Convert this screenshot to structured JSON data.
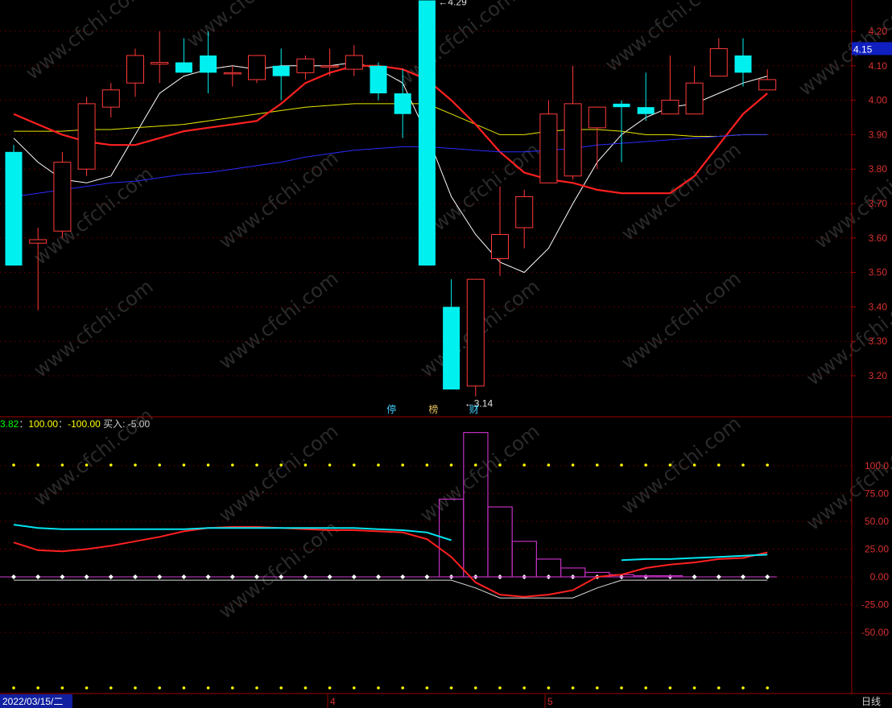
{
  "chart_data": [
    {
      "type": "candlestick",
      "title": "",
      "ylim": [
        3.1,
        4.3
      ],
      "y_ticks": [
        "4.20",
        "4.10",
        "4.00",
        "3.90",
        "3.80",
        "3.70",
        "3.60",
        "3.50",
        "3.40",
        "3.30",
        "3.20"
      ],
      "last_price": "4.15",
      "high_label": "4.29",
      "low_label": "3.14",
      "event_labels": [
        "停",
        "榜",
        "财"
      ],
      "colors": {
        "up": "#ff3a3a",
        "down": "#00f0f0",
        "ma1": "#ffffff",
        "ma2": "#e8e800",
        "ma3": "#ff2020",
        "ma4": "#2a2aff"
      },
      "candles": [
        {
          "o": 3.85,
          "h": 3.87,
          "l": 3.52,
          "c": 3.52
        },
        {
          "o": 3.585,
          "h": 3.63,
          "l": 3.39,
          "c": 3.595
        },
        {
          "o": 3.62,
          "h": 3.85,
          "l": 3.6,
          "c": 3.82
        },
        {
          "o": 3.8,
          "h": 4.01,
          "l": 3.78,
          "c": 3.99
        },
        {
          "o": 3.98,
          "h": 4.05,
          "l": 3.95,
          "c": 4.03
        },
        {
          "o": 4.05,
          "h": 4.15,
          "l": 4.01,
          "c": 4.13
        },
        {
          "o": 4.105,
          "h": 4.2,
          "l": 4.05,
          "c": 4.11
        },
        {
          "o": 4.11,
          "h": 4.18,
          "l": 4.08,
          "c": 4.08
        },
        {
          "o": 4.13,
          "h": 4.2,
          "l": 4.02,
          "c": 4.08
        },
        {
          "o": 4.08,
          "h": 4.1,
          "l": 4.04,
          "c": 4.08
        },
        {
          "o": 4.06,
          "h": 4.13,
          "l": 4.05,
          "c": 4.13
        },
        {
          "o": 4.1,
          "h": 4.15,
          "l": 4.0,
          "c": 4.07
        },
        {
          "o": 4.08,
          "h": 4.13,
          "l": 4.06,
          "c": 4.12
        },
        {
          "o": 4.1,
          "h": 4.15,
          "l": 4.07,
          "c": 4.1
        },
        {
          "o": 4.09,
          "h": 4.16,
          "l": 4.07,
          "c": 4.13
        },
        {
          "o": 4.1,
          "h": 4.11,
          "l": 4.0,
          "c": 4.02
        },
        {
          "o": 4.02,
          "h": 4.09,
          "l": 3.89,
          "c": 3.96
        },
        {
          "o": 4.29,
          "h": 4.29,
          "l": 3.52,
          "c": 3.52
        },
        {
          "o": 3.4,
          "h": 3.48,
          "l": 3.16,
          "c": 3.16
        },
        {
          "o": 3.17,
          "h": 3.48,
          "l": 3.14,
          "c": 3.48
        },
        {
          "o": 3.54,
          "h": 3.75,
          "l": 3.49,
          "c": 3.61
        },
        {
          "o": 3.63,
          "h": 3.74,
          "l": 3.57,
          "c": 3.72
        },
        {
          "o": 3.76,
          "h": 4.0,
          "l": 3.76,
          "c": 3.96
        },
        {
          "o": 3.78,
          "h": 4.1,
          "l": 3.77,
          "c": 3.99
        },
        {
          "o": 3.92,
          "h": 3.98,
          "l": 3.8,
          "c": 3.98
        },
        {
          "o": 3.99,
          "h": 4.0,
          "l": 3.82,
          "c": 3.98
        },
        {
          "o": 3.98,
          "h": 4.08,
          "l": 3.94,
          "c": 3.96
        },
        {
          "o": 3.96,
          "h": 4.13,
          "l": 3.96,
          "c": 4.0
        },
        {
          "o": 3.96,
          "h": 4.1,
          "l": 3.96,
          "c": 4.05
        },
        {
          "o": 4.07,
          "h": 4.18,
          "l": 4.07,
          "c": 4.15
        },
        {
          "o": 4.13,
          "h": 4.18,
          "l": 4.04,
          "c": 4.08
        },
        {
          "o": 4.03,
          "h": 4.09,
          "l": 4.03,
          "c": 4.06
        }
      ],
      "ma_lines": [
        {
          "name": "ma1",
          "values": [
            3.89,
            3.82,
            3.77,
            3.76,
            3.78,
            3.9,
            4.02,
            4.07,
            4.09,
            4.1,
            4.09,
            4.1,
            4.1,
            4.1,
            4.11,
            4.09,
            4.05,
            3.9,
            3.72,
            3.61,
            3.53,
            3.5,
            3.57,
            3.7,
            3.82,
            3.9,
            3.95,
            3.98,
            3.99,
            4.02,
            4.05,
            4.07
          ]
        },
        {
          "name": "ma2",
          "values": [
            3.91,
            3.91,
            3.91,
            3.915,
            3.915,
            3.92,
            3.925,
            3.93,
            3.94,
            3.95,
            3.96,
            3.97,
            3.98,
            3.985,
            3.99,
            3.99,
            3.99,
            3.99,
            3.96,
            3.93,
            3.9,
            3.9,
            3.91,
            3.915,
            3.915,
            3.91,
            3.9,
            3.9,
            3.895,
            3.895,
            3.9,
            3.9
          ]
        },
        {
          "name": "ma3",
          "values": [
            3.96,
            3.93,
            3.9,
            3.88,
            3.87,
            3.87,
            3.89,
            3.91,
            3.92,
            3.93,
            3.94,
            3.99,
            4.05,
            4.08,
            4.1,
            4.1,
            4.09,
            4.06,
            4.0,
            3.93,
            3.85,
            3.79,
            3.77,
            3.76,
            3.74,
            3.73,
            3.73,
            3.73,
            3.78,
            3.87,
            3.96,
            4.02
          ]
        },
        {
          "name": "ma4",
          "values": [
            3.72,
            3.73,
            3.74,
            3.75,
            3.76,
            3.765,
            3.775,
            3.785,
            3.79,
            3.8,
            3.81,
            3.82,
            3.835,
            3.845,
            3.855,
            3.86,
            3.865,
            3.865,
            3.86,
            3.855,
            3.85,
            3.85,
            3.855,
            3.86,
            3.87,
            3.875,
            3.88,
            3.885,
            3.89,
            3.895,
            3.9,
            3.9
          ]
        }
      ]
    },
    {
      "type": "indicator",
      "title_prefix": "",
      "header": [
        {
          "text": "3.82",
          "color": "#00ff00"
        },
        {
          "text": "：",
          "color": "#cccccc"
        },
        {
          "text": "100.00",
          "color": "#ffff00"
        },
        {
          "text": "：",
          "color": "#cccccc"
        },
        {
          "text": "-100.00",
          "color": "#ffff00"
        },
        {
          "text": "  买入: -5.00",
          "color": "#cccccc"
        }
      ],
      "ylim": [
        -110,
        135
      ],
      "y_ticks": [
        "100.0",
        "75.00",
        "50.00",
        "25.00",
        "0.00",
        "-25.00",
        "-50.00"
      ],
      "bars": [
        0,
        0,
        0,
        0,
        0,
        0,
        0,
        0,
        0,
        0,
        0,
        0,
        0,
        0,
        0,
        0,
        0,
        0,
        70,
        130,
        63,
        32,
        16,
        8,
        4,
        2,
        1,
        1,
        0,
        0,
        0,
        0
      ],
      "lines": [
        {
          "name": "red",
          "color": "#ff2020",
          "values": [
            31,
            24,
            23,
            25,
            28,
            32,
            36,
            41,
            44,
            45,
            45,
            44,
            43,
            42,
            42,
            41,
            40,
            34,
            18,
            -5,
            -16,
            -18,
            -16,
            -12,
            0,
            2,
            8,
            11,
            13,
            16,
            17,
            22
          ]
        },
        {
          "name": "cyan",
          "color": "#00e5f0",
          "values": [
            47,
            44,
            43,
            43,
            43,
            43,
            43,
            43,
            44,
            44,
            44,
            44,
            44,
            44,
            44,
            43,
            42,
            40,
            33,
            null,
            null,
            null,
            null,
            null,
            null,
            15,
            16,
            16,
            17,
            18,
            19,
            20
          ]
        },
        {
          "name": "white",
          "color": "#dddddd",
          "values": [
            -3,
            -3,
            -3,
            -3,
            -3,
            -3,
            -3,
            -3,
            -3,
            -3,
            -3,
            -3,
            -3,
            -3,
            -3,
            -3,
            -3,
            -3,
            -3,
            -10,
            -19,
            -19,
            -19,
            -19,
            -10,
            -3,
            -3,
            -3,
            -3,
            -3,
            -3,
            -3
          ]
        }
      ]
    }
  ],
  "footer": {
    "date": "2022/03/15/二",
    "month_4": "4",
    "month_5": "5",
    "period": "日线"
  },
  "watermark": "www.cfchi.com"
}
